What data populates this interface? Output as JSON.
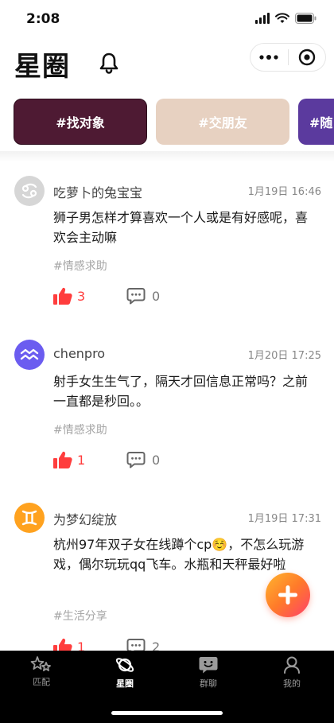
{
  "status_bar": {
    "time": "2:08"
  },
  "header": {
    "title": "星圈"
  },
  "chips": [
    {
      "label": "#找对象",
      "color": "#4e1a33"
    },
    {
      "label": "#交朋友",
      "color": "#e7d1c1"
    },
    {
      "label": "#随",
      "color": "#5b3a9e"
    }
  ],
  "posts": [
    {
      "username": "吃萝卜的兔宝宝",
      "time": "1月19日 16:46",
      "content": "狮子男怎样才算喜欢一个人或是有好感呢，喜欢会主动嘛",
      "tag": "#情感求助",
      "likes": "3",
      "comments": "0",
      "avatar_icon": "cancer-zodiac-icon",
      "avatar_color": "#d6d6d6"
    },
    {
      "username": "chenpro",
      "time": "1月20日 17:25",
      "content": "射手女生生气了，隔天才回信息正常吗？之前一直都是秒回。。",
      "tag": "#情感求助",
      "likes": "1",
      "comments": "0",
      "avatar_icon": "aquarius-zodiac-icon",
      "avatar_color": "#6b5cf0"
    },
    {
      "username": "为梦幻绽放",
      "time": "1月19日 17:31",
      "content": "杭州97年双子女在线蹲个cp☺️，不怎么玩游戏，偶尔玩玩qq飞车。水瓶和天秤最好啦",
      "tag": "#生活分享",
      "likes": "1",
      "comments": "2",
      "avatar_icon": "gemini-zodiac-icon",
      "avatar_color": "#ffa21f"
    }
  ],
  "tabbar": {
    "tabs": [
      {
        "label": "匹配",
        "icon": "stars-icon",
        "active": false
      },
      {
        "label": "星圈",
        "icon": "planet-icon",
        "active": true
      },
      {
        "label": "群聊",
        "icon": "chat-face-icon",
        "active": false
      },
      {
        "label": "我的",
        "icon": "person-icon",
        "active": false
      }
    ]
  },
  "colors": {
    "like_red": "#ff3d3d",
    "tag_gray": "#a6a6a6",
    "tabbar_bg": "#000000"
  }
}
